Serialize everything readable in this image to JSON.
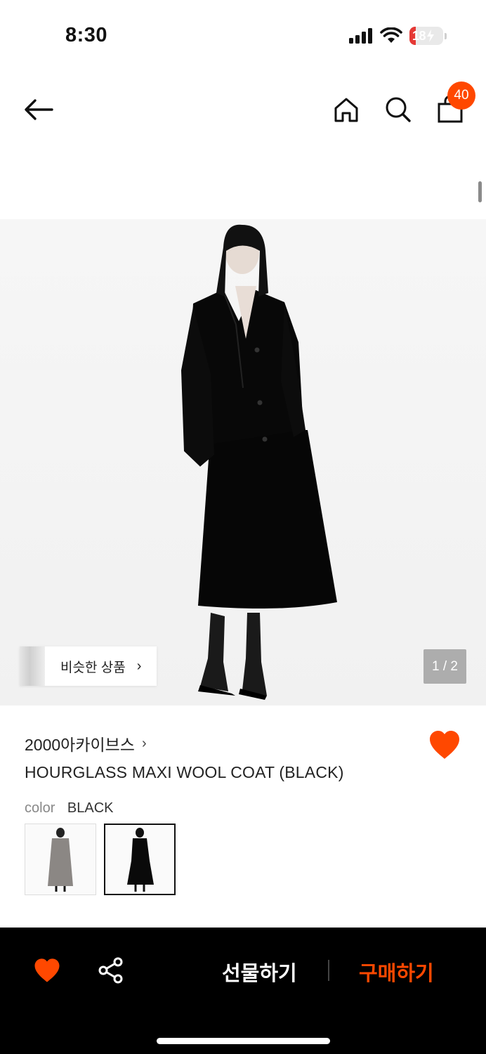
{
  "status_bar": {
    "time": "8:30",
    "battery": "18",
    "battery_level": 0.18
  },
  "header": {
    "cart_count": "40"
  },
  "product_image": {
    "similar_label": "비슷한 상품",
    "page_indicator": "1 / 2"
  },
  "product": {
    "brand": "2000아카이브스",
    "title": "HOURGLASS MAXI WOOL COAT (BLACK)",
    "color_label": "color",
    "color_value": "BLACK",
    "swatches": [
      "grey-coat",
      "black-coat"
    ]
  },
  "bottom_bar": {
    "gift_label": "선물하기",
    "buy_label": "구매하기"
  },
  "colors": {
    "accent": "#ff4800",
    "heart": "#ff4800",
    "bar_bg": "#000000"
  }
}
